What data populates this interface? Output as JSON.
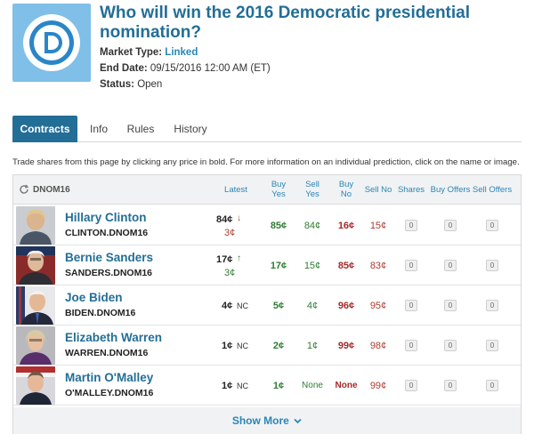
{
  "market": {
    "title": "Who will win the 2016 Democratic presidential nomination?",
    "type_label": "Market Type:",
    "type_value": "Linked",
    "end_label": "End Date:",
    "end_value": "09/15/2016 12:00 AM (ET)",
    "status_label": "Status:",
    "status_value": "Open",
    "logo_letter": "D"
  },
  "tabs": [
    "Contracts",
    "Info",
    "Rules",
    "History"
  ],
  "active_tab": "Contracts",
  "instructions": "Trade shares from this page by clicking any price in bold. For more information on an individual prediction, click on the name or image.",
  "table": {
    "code": "DNOM16",
    "headers": {
      "latest": "Latest",
      "buy_yes": "Buy Yes",
      "sell_yes": "Sell Yes",
      "buy_no": "Buy No",
      "sell_no": "Sell No",
      "shares": "Shares",
      "buy_offers": "Buy Offers",
      "sell_offers": "Sell Offers"
    },
    "rows": [
      {
        "name": "Hillary Clinton",
        "code": "CLINTON.DNOM16",
        "latest": "84¢",
        "trend": "down",
        "change": "3¢",
        "buy_yes": "85¢",
        "sell_yes": "84¢",
        "buy_no": "16¢",
        "sell_no": "15¢",
        "shares": "0",
        "buy_offers": "0",
        "sell_offers": "0"
      },
      {
        "name": "Bernie Sanders",
        "code": "SANDERS.DNOM16",
        "latest": "17¢",
        "trend": "up",
        "change": "3¢",
        "buy_yes": "17¢",
        "sell_yes": "15¢",
        "buy_no": "85¢",
        "sell_no": "83¢",
        "shares": "0",
        "buy_offers": "0",
        "sell_offers": "0"
      },
      {
        "name": "Joe Biden",
        "code": "BIDEN.DNOM16",
        "latest": "4¢",
        "trend": "none",
        "change": "NC",
        "buy_yes": "5¢",
        "sell_yes": "4¢",
        "buy_no": "96¢",
        "sell_no": "95¢",
        "shares": "0",
        "buy_offers": "0",
        "sell_offers": "0"
      },
      {
        "name": "Elizabeth Warren",
        "code": "WARREN.DNOM16",
        "latest": "1¢",
        "trend": "none",
        "change": "NC",
        "buy_yes": "2¢",
        "sell_yes": "1¢",
        "buy_no": "99¢",
        "sell_no": "98¢",
        "shares": "0",
        "buy_offers": "0",
        "sell_offers": "0"
      },
      {
        "name": "Martin O'Malley",
        "code": "O'MALLEY.DNOM16",
        "latest": "1¢",
        "trend": "none",
        "change": "NC",
        "buy_yes": "1¢",
        "sell_yes": "None",
        "buy_no": "None",
        "sell_no": "99¢",
        "shares": "0",
        "buy_offers": "0",
        "sell_offers": "0"
      }
    ],
    "show_more": "Show More"
  },
  "colors": {
    "brand": "#236e96",
    "link": "#2a86b8",
    "green": "#2e7d32",
    "red": "#a52a2a",
    "logo_bg": "#7fbfe8"
  }
}
